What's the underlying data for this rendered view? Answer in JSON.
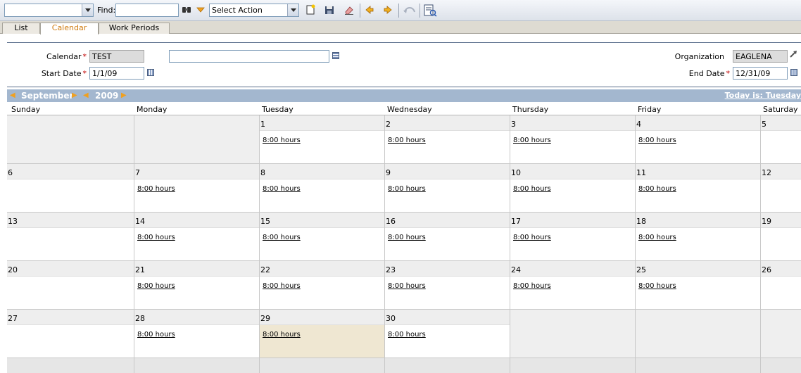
{
  "toolbar": {
    "find_label": "Find:",
    "action_select": "Select Action",
    "icons": [
      "binoculars-icon",
      "filter-icon",
      "new-record-icon",
      "save-icon",
      "eraser-icon",
      "previous-icon",
      "next-icon",
      "undo-icon",
      "report-icon"
    ]
  },
  "tabs": [
    {
      "label": "List"
    },
    {
      "label": "Calendar"
    },
    {
      "label": "Work Periods"
    }
  ],
  "form": {
    "calendar_label": "Calendar",
    "calendar_value": "TEST",
    "description_value": "",
    "start_date_label": "Start Date",
    "start_date_value": "1/1/09",
    "organization_label": "Organization",
    "organization_value": "EAGLENA",
    "end_date_label": "End Date",
    "end_date_value": "12/31/09",
    "required_marker": "*"
  },
  "calendar": {
    "month": "September",
    "year": "2009",
    "today_text": "Today is: Tuesday",
    "days": [
      "Sunday",
      "Monday",
      "Tuesday",
      "Wednesday",
      "Thursday",
      "Friday",
      "Saturday"
    ],
    "hours_text": "8:00 hours",
    "weeks": [
      [
        "",
        "",
        "1",
        "2",
        "3",
        "4",
        "5"
      ],
      [
        "6",
        "7",
        "8",
        "9",
        "10",
        "11",
        "12"
      ],
      [
        "13",
        "14",
        "15",
        "16",
        "17",
        "18",
        "19"
      ],
      [
        "20",
        "21",
        "22",
        "23",
        "24",
        "25",
        "26"
      ],
      [
        "27",
        "28",
        "29",
        "30",
        "",
        "",
        ""
      ]
    ],
    "today_day": "29"
  }
}
